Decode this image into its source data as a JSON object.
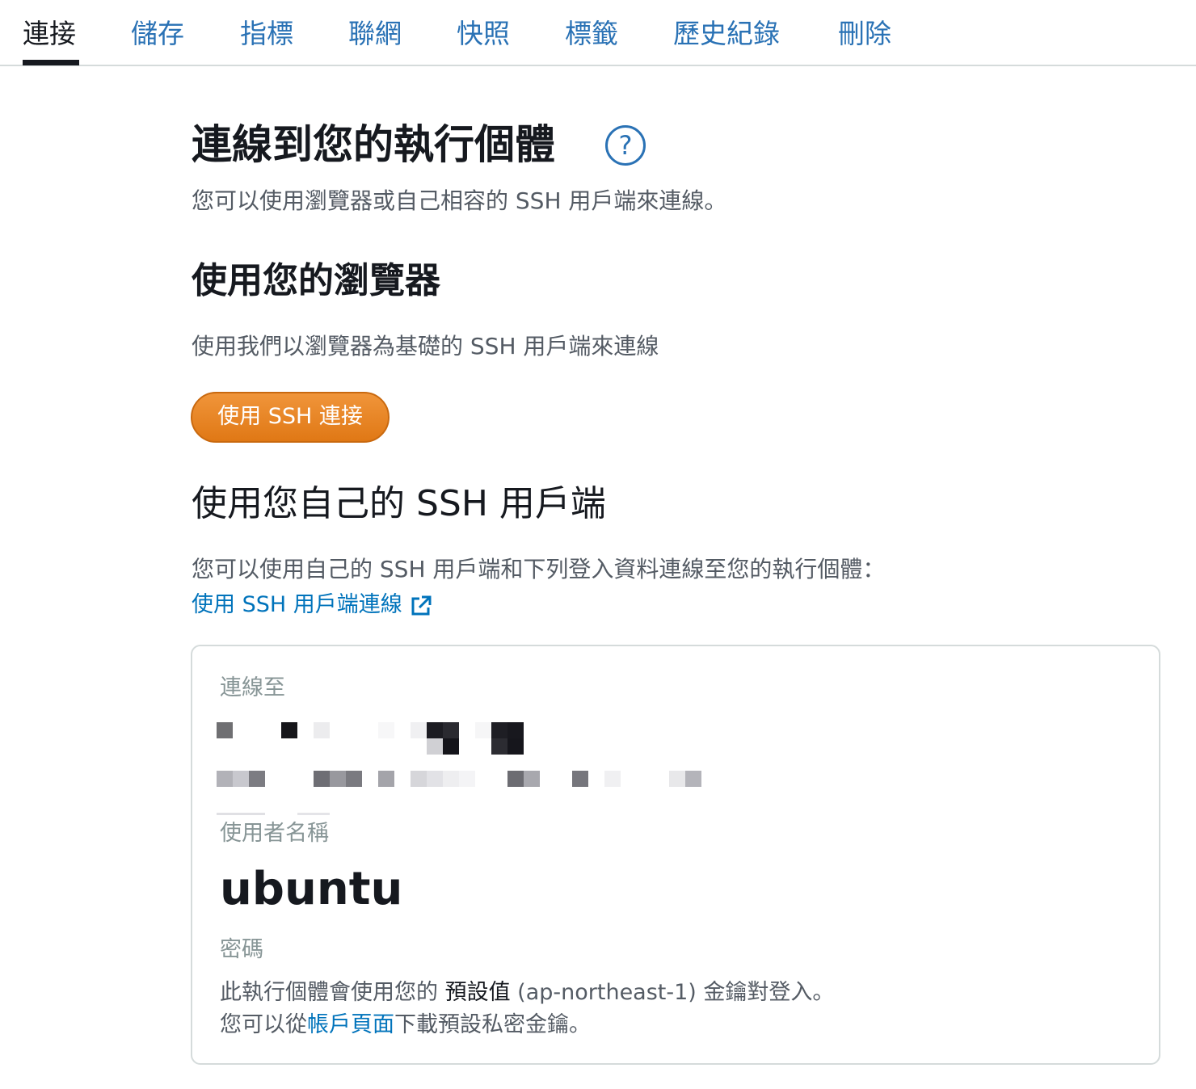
{
  "tabs": [
    {
      "label": "連接",
      "active": true
    },
    {
      "label": "儲存"
    },
    {
      "label": "指標"
    },
    {
      "label": "聯網"
    },
    {
      "label": "快照"
    },
    {
      "label": "標籤"
    },
    {
      "label": "歷史紀錄"
    },
    {
      "label": "刪除"
    }
  ],
  "header": {
    "title": "連線到您的執行個體",
    "help_icon": "?",
    "subtitle": "您可以使用瀏覽器或自己相容的 SSH 用戶端來連線。"
  },
  "browser_section": {
    "title": "使用您的瀏覽器",
    "description": "使用我們以瀏覽器為基礎的 SSH 用戶端來連線",
    "button_label": "使用 SSH 連接"
  },
  "own_client_section": {
    "title": "使用您自己的 SSH 用戶端",
    "description": "您可以使用自己的 SSH 用戶端和下列登入資料連線至您的執行個體：",
    "link_label": "使用 SSH 用戶端連線",
    "link_icon": "external-link-icon"
  },
  "credentials": {
    "connect_to_label": "連線至",
    "username_label": "使用者名稱",
    "username_value": "ubuntu",
    "password_label": "密碼",
    "password_line1_prefix": "此執行個體會使用您的 ",
    "password_line1_strong": "預設值",
    "password_line1_suffix": " (ap-northeast-1) 金鑰對登入。",
    "password_line2_prefix": "您可以從",
    "password_line2_link": "帳戶頁面",
    "password_line2_suffix": "下載預設私密金鑰。"
  },
  "colors": {
    "link": "#0073bb",
    "tab_link": "#2a72b5",
    "button_orange": "#ec7211",
    "text_dark": "#16191f",
    "text_muted": "#545b64"
  }
}
